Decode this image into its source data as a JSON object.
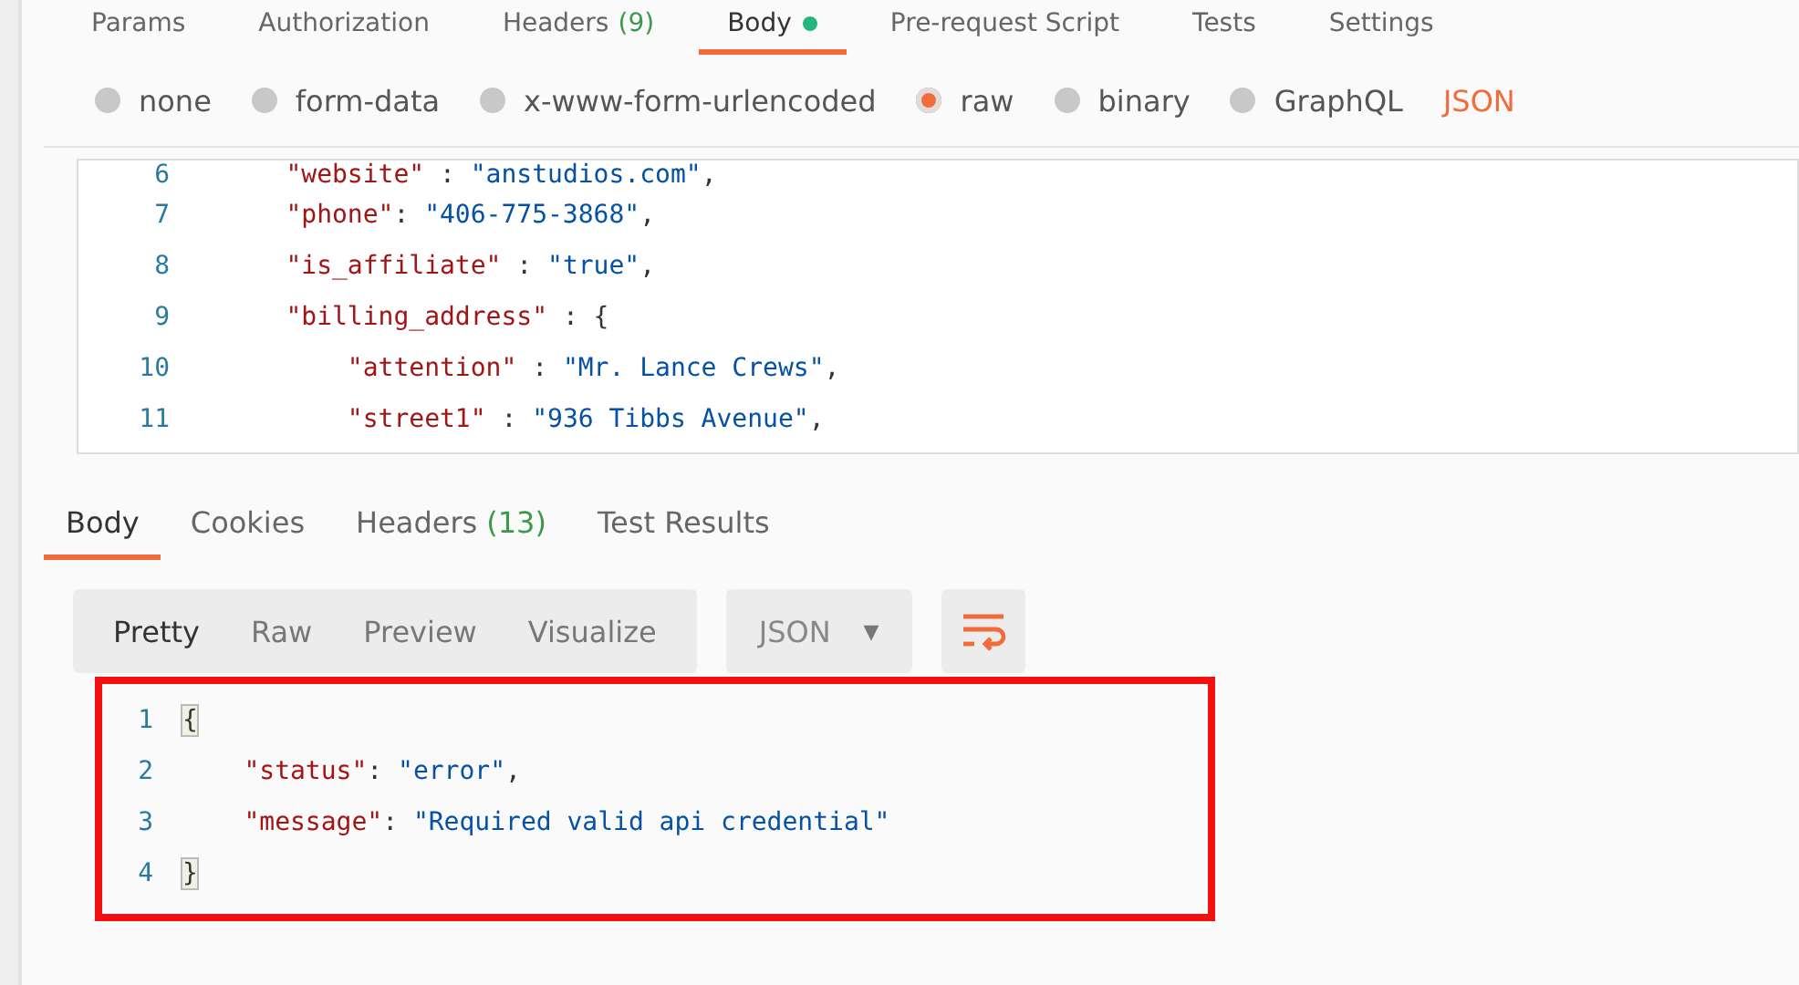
{
  "request_tabs": [
    {
      "label": "Params",
      "selected": false
    },
    {
      "label": "Authorization",
      "selected": false
    },
    {
      "label": "Headers",
      "count": "(9)",
      "selected": false
    },
    {
      "label": "Body",
      "dot": true,
      "selected": true
    },
    {
      "label": "Pre-request Script",
      "selected": false
    },
    {
      "label": "Tests",
      "selected": false
    },
    {
      "label": "Settings",
      "selected": false
    }
  ],
  "body_types": [
    {
      "label": "none",
      "selected": false
    },
    {
      "label": "form-data",
      "selected": false
    },
    {
      "label": "x-www-form-urlencoded",
      "selected": false
    },
    {
      "label": "raw",
      "selected": true
    },
    {
      "label": "binary",
      "selected": false
    },
    {
      "label": "GraphQL",
      "selected": false
    }
  ],
  "format_label": "JSON",
  "request_editor": {
    "lines": [
      {
        "number": "6",
        "tokens": [
          {
            "kind": "key",
            "text": "    \"website\""
          },
          {
            "kind": "punct",
            "text": " : "
          },
          {
            "kind": "string",
            "text": "\"anstudios.com\""
          },
          {
            "kind": "punct",
            "text": ","
          }
        ]
      },
      {
        "number": "7",
        "tokens": [
          {
            "kind": "key",
            "text": "    \"phone\""
          },
          {
            "kind": "punct",
            "text": ": "
          },
          {
            "kind": "string",
            "text": "\"406-775-3868\""
          },
          {
            "kind": "punct",
            "text": ","
          }
        ]
      },
      {
        "number": "8",
        "tokens": [
          {
            "kind": "key",
            "text": "    \"is_affiliate\""
          },
          {
            "kind": "punct",
            "text": " : "
          },
          {
            "kind": "string",
            "text": "\"true\""
          },
          {
            "kind": "punct",
            "text": ","
          }
        ]
      },
      {
        "number": "9",
        "tokens": [
          {
            "kind": "key",
            "text": "    \"billing_address\""
          },
          {
            "kind": "punct",
            "text": " : {"
          }
        ]
      },
      {
        "number": "10",
        "tokens": [
          {
            "kind": "key",
            "text": "        \"attention\""
          },
          {
            "kind": "punct",
            "text": " : "
          },
          {
            "kind": "string",
            "text": "\"Mr. Lance Crews\""
          },
          {
            "kind": "punct",
            "text": ","
          }
        ]
      },
      {
        "number": "11",
        "tokens": [
          {
            "kind": "key",
            "text": "        \"street1\""
          },
          {
            "kind": "punct",
            "text": " : "
          },
          {
            "kind": "string",
            "text": "\"936 Tibbs Avenue\""
          },
          {
            "kind": "punct",
            "text": ","
          }
        ]
      }
    ]
  },
  "response_tabs": [
    {
      "label": "Body",
      "selected": true
    },
    {
      "label": "Cookies",
      "selected": false
    },
    {
      "label": "Headers",
      "count": "(13)",
      "selected": false
    },
    {
      "label": "Test Results",
      "selected": false
    }
  ],
  "view_modes": [
    {
      "label": "Pretty",
      "selected": true
    },
    {
      "label": "Raw",
      "selected": false
    },
    {
      "label": "Preview",
      "selected": false
    },
    {
      "label": "Visualize",
      "selected": false
    }
  ],
  "response_format": {
    "value": "JSON",
    "caret": "▼"
  },
  "response_body": {
    "lines": [
      {
        "number": "1",
        "tokens": [
          {
            "kind": "bracket",
            "text": "{"
          }
        ]
      },
      {
        "number": "2",
        "tokens": [
          {
            "kind": "key",
            "text": "    \"status\""
          },
          {
            "kind": "punct",
            "text": ": "
          },
          {
            "kind": "string",
            "text": "\"error\""
          },
          {
            "kind": "punct",
            "text": ","
          }
        ]
      },
      {
        "number": "3",
        "tokens": [
          {
            "kind": "key",
            "text": "    \"message\""
          },
          {
            "kind": "punct",
            "text": ": "
          },
          {
            "kind": "string",
            "text": "\"Required valid api credential\""
          }
        ]
      },
      {
        "number": "4",
        "tokens": [
          {
            "kind": "bracket",
            "text": "}"
          }
        ]
      }
    ]
  }
}
